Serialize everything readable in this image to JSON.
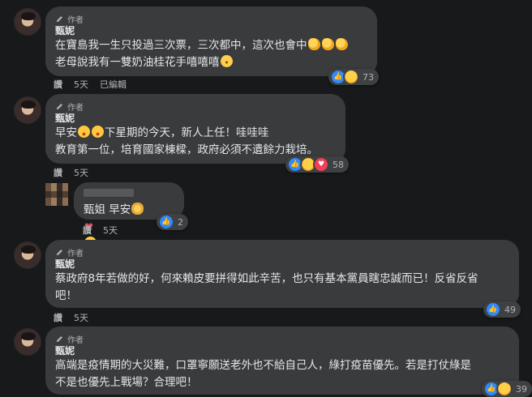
{
  "author_badge": "作者",
  "comments": [
    {
      "name": "甄妮",
      "lines": [
        "在寶島我一生只投過三次票，三次都中，這次也會中",
        "老母說我有一雙奶油桂花手嘻嘻嘻"
      ],
      "like": "讚",
      "time": "5天",
      "edited": "已編輯",
      "reaction_count": "73"
    },
    {
      "name": "甄妮",
      "lines": [
        "早安",
        "下星期的今天，新人上任！哇哇哇",
        "教育第一位，培育國家棟樑，政府必須不遺餘力栽培。"
      ],
      "like": "讚",
      "time": "5天",
      "reaction_count": "58"
    },
    {
      "name": "",
      "lines": [
        "甄姐 早安"
      ],
      "like": "讚",
      "time": "5天",
      "reaction_count": "2"
    },
    {
      "name": "甄妮",
      "lines": [
        "蔡政府8年若做的好，何來賴皮要拼得如此辛苦，也只有基本黨員瞎忠誠而已！反省反省",
        "吧！"
      ],
      "like": "讚",
      "time": "5天",
      "reaction_count": "49"
    },
    {
      "name": "甄妮",
      "lines": [
        "高端是疫情期的大災難，口罩寧願送老外也不給自己人，綠打疫苗優先。若是打仗綠是",
        "不是也優先上戰場？合理吧！"
      ],
      "reaction_count": "39"
    }
  ],
  "icons": {
    "author": "pencil-icon",
    "like_reaction": "thumbs-up-icon",
    "care_reaction": "care-face-icon",
    "love_reaction": "heart-icon"
  },
  "colors": {
    "background": "#18191a",
    "bubble": "#3a3b3c",
    "like_blue": "#2e89ff",
    "love_red": "#f33e58"
  }
}
